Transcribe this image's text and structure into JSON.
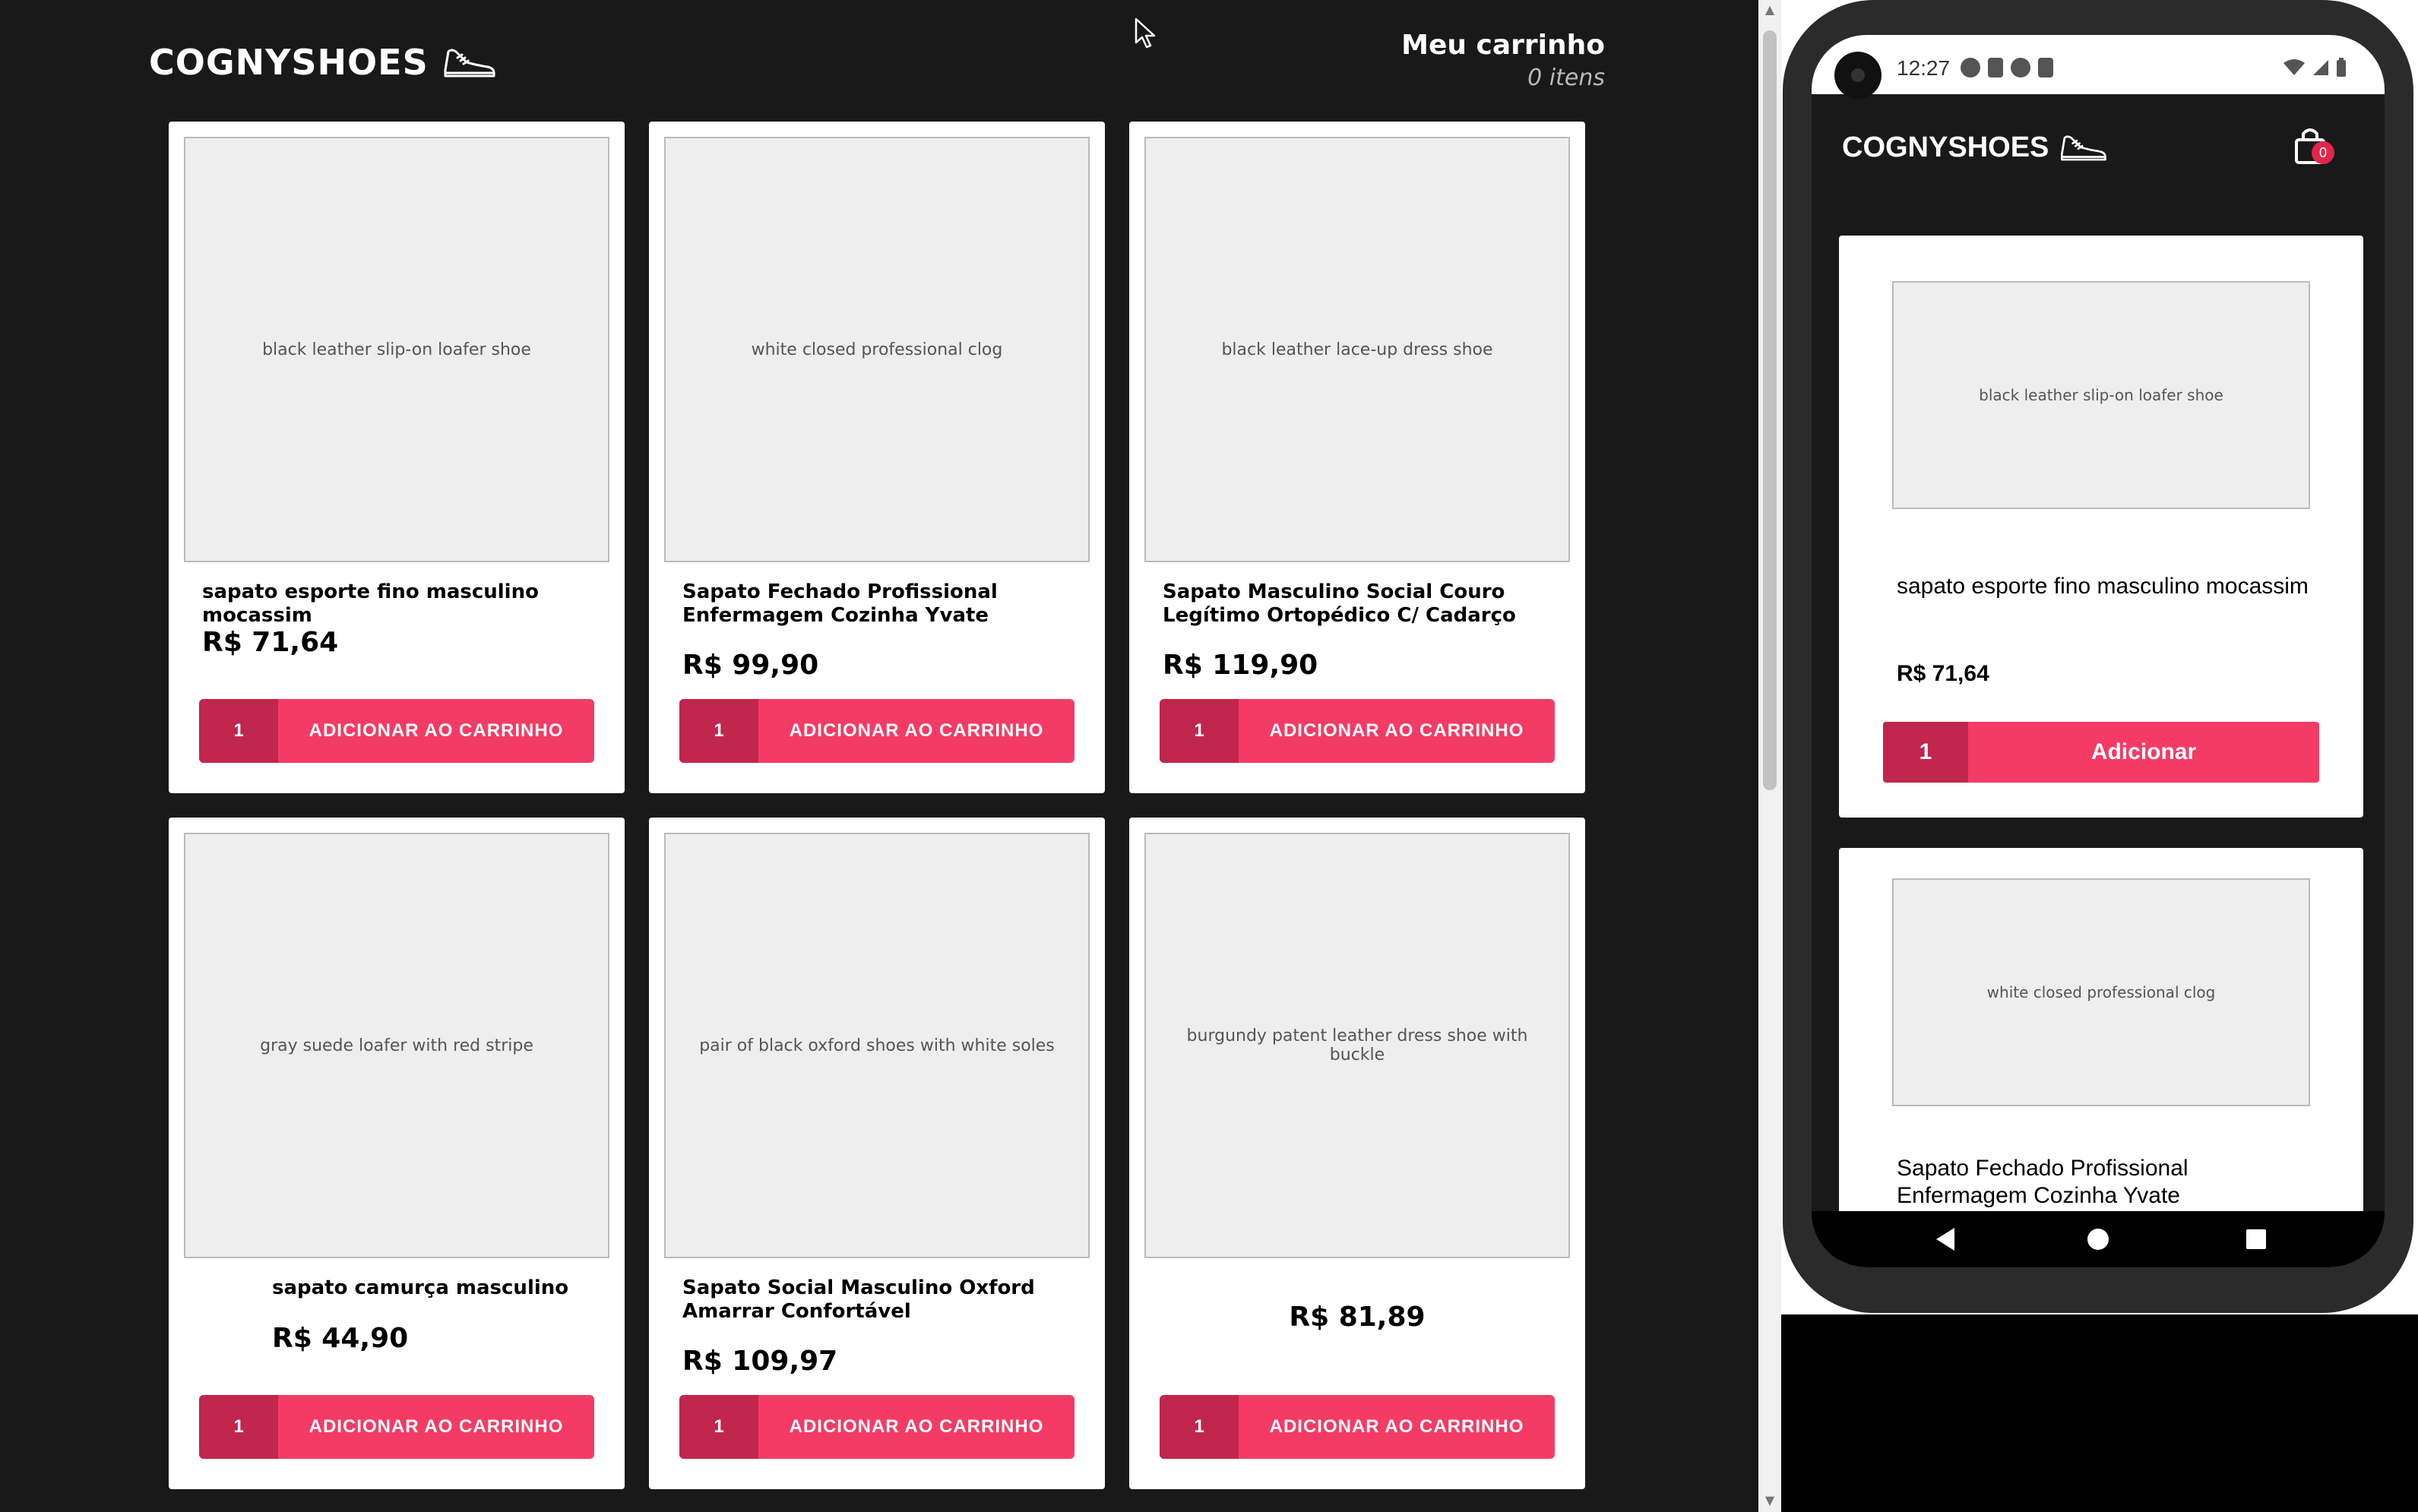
{
  "brand": {
    "name": "COGNYSHOES",
    "icon": "sneaker-icon"
  },
  "cart": {
    "title": "Meu carrinho",
    "count_label": "0 itens"
  },
  "web_products": [
    {
      "title": "sapato esporte fino masculino mocassim",
      "price": "R$ 71,64",
      "qty": "1",
      "button": "ADICIONAR AO CARRINHO",
      "image_alt": "black leather slip-on loafer shoe"
    },
    {
      "title": "Sapato Fechado Profissional Enfermagem Cozinha Yvate",
      "price": "R$ 99,90",
      "qty": "1",
      "button": "ADICIONAR AO CARRINHO",
      "image_alt": "white closed professional clog"
    },
    {
      "title": "Sapato Masculino Social Couro Legítimo Ortopédico C/ Cadarço",
      "price": "R$ 119,90",
      "qty": "1",
      "button": "ADICIONAR AO CARRINHO",
      "image_alt": "black leather lace-up dress shoe"
    },
    {
      "title": "sapato camurça masculino",
      "price": "R$ 44,90",
      "qty": "1",
      "button": "ADICIONAR AO CARRINHO",
      "image_alt": "gray suede loafer with red stripe"
    },
    {
      "title": "Sapato Social Masculino Oxford Amarrar Confortável",
      "price": "R$ 109,97",
      "qty": "1",
      "button": "ADICIONAR AO CARRINHO",
      "image_alt": "pair of black oxford shoes with white soles"
    },
    {
      "title": "",
      "price": "R$ 81,89",
      "qty": "1",
      "button": "ADICIONAR AO CARRINHO",
      "image_alt": "burgundy patent leather dress shoe with buckle"
    }
  ],
  "mobile": {
    "status_time": "12:27",
    "cart_badge": "0",
    "products": [
      {
        "title": "sapato esporte fino masculino mocassim",
        "price": "R$ 71,64",
        "qty": "1",
        "button": "Adicionar",
        "image_alt": "black leather slip-on loafer shoe"
      },
      {
        "title": "Sapato Fechado Profissional Enfermagem Cozinha Yvate",
        "image_alt": "white closed professional clog"
      }
    ]
  },
  "colors": {
    "accent": "#f43b65",
    "accent_dark": "#c1264c",
    "background": "#191919",
    "card": "#ffffff"
  }
}
